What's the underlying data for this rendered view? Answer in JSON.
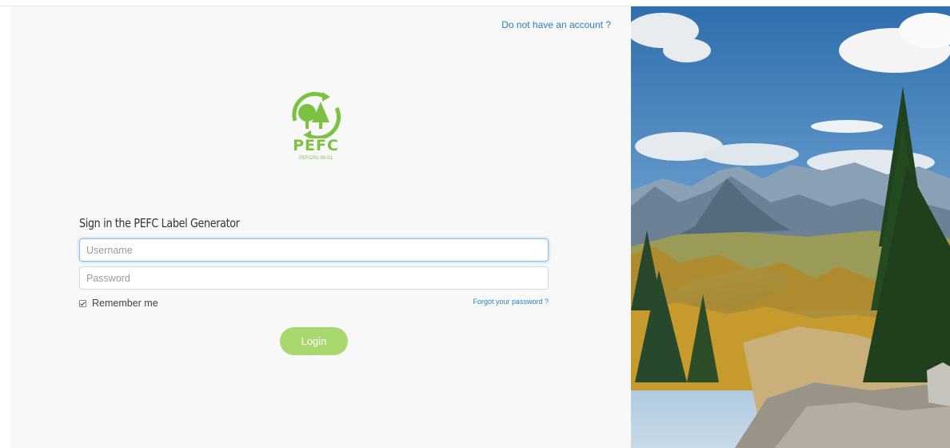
{
  "header": {
    "signup_link": "Do not have an account ?"
  },
  "logo": {
    "text": "PEFC",
    "certificate": "PEFC/01-00-01",
    "brand_color": "#7cc242"
  },
  "form": {
    "title": "Sign in the PEFC Label Generator",
    "username_placeholder": "Username",
    "password_placeholder": "Password",
    "remember_label": "Remember me",
    "remember_checked": true,
    "forgot_link": "Forgot your password ?",
    "login_label": "Login",
    "login_color": "#a9d86e"
  },
  "hero": {
    "description_icon": "mountain-lake-landscape-image"
  }
}
